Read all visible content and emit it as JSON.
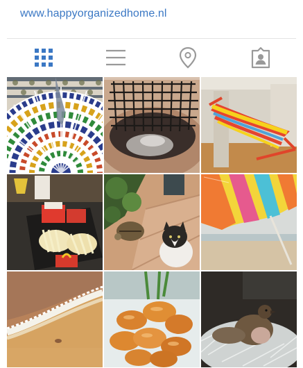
{
  "header": {
    "url": "www.happyorganizedhome.nl",
    "link_color": "#3b78c4"
  },
  "tabs": [
    {
      "icon": "grid-icon",
      "active": true,
      "color": "#3b78c4"
    },
    {
      "icon": "list-icon",
      "active": false,
      "color": "#999999"
    },
    {
      "icon": "location-pin-icon",
      "active": false,
      "color": "#999999"
    },
    {
      "icon": "tagged-person-icon",
      "active": false,
      "color": "#999999"
    }
  ],
  "photos": [
    {
      "subject": "mosaic-tiles"
    },
    {
      "subject": "grill-rack"
    },
    {
      "subject": "hammock"
    },
    {
      "subject": "fast-food-tray"
    },
    {
      "subject": "tortoise-and-cat"
    },
    {
      "subject": "beach-umbrella"
    },
    {
      "subject": "sand-and-wave"
    },
    {
      "subject": "pastries"
    },
    {
      "subject": "bird-in-nest"
    }
  ]
}
